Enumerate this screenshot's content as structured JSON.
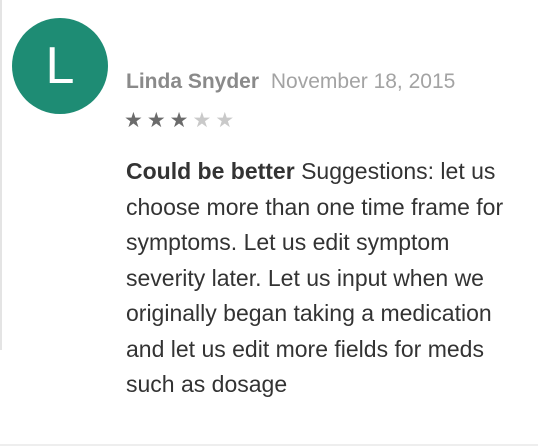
{
  "review": {
    "avatar_letter": "L",
    "author": "Linda Snyder",
    "date": "November 18, 2015",
    "rating": 3,
    "max_rating": 5,
    "title": "Could be better",
    "body": "Suggestions: let us choose more than one time frame for symptoms. Let us edit symptom severity later. Let us input when we originally began taking a medication and let us edit more fields for meds such as dosage"
  },
  "colors": {
    "avatar_background": "#1e8c74",
    "star_filled": "#6b6b6b",
    "star_empty": "#c9c9c9"
  },
  "icons": {
    "star": "star-icon"
  }
}
